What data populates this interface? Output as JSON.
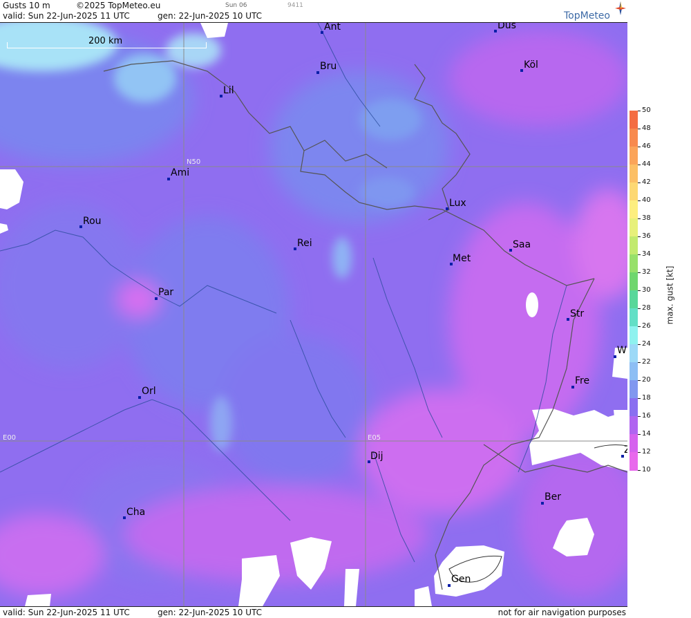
{
  "header": {
    "product": "Gusts 10 m",
    "copyright": "©2025 TopMeteo.eu",
    "run_tag": "Sun 06",
    "code": "9411",
    "valid": "valid:  Sun  22-Jun-2025  11 UTC",
    "gen": "gen: 22-Jun-2025 10 UTC",
    "logo_text": "TopMeteo"
  },
  "footer": {
    "valid": "valid:  Sun  22-Jun-2025  11 UTC",
    "gen": "gen: 22-Jun-2025 10 UTC",
    "disclaimer": "not for air navigation purposes"
  },
  "map": {
    "scale_label": "200 km",
    "grid_labels": [
      "N50",
      "E00",
      "E05"
    ],
    "cities": [
      "Ant",
      "Düs",
      "Bru",
      "Köl",
      "Lil",
      "Ami",
      "Lux",
      "Rou",
      "Rei",
      "Saa",
      "Met",
      "Par",
      "Str",
      "W",
      "Fre",
      "Orl",
      "Dij",
      "Ber",
      "Cha",
      "Gen",
      "Z"
    ]
  },
  "colorbar": {
    "title": "max. gust  [kt]",
    "ticks": [
      "50",
      "48",
      "46",
      "44",
      "42",
      "40",
      "38",
      "36",
      "34",
      "32",
      "30",
      "28",
      "26",
      "24",
      "22",
      "20",
      "18",
      "16",
      "14",
      "12",
      "10"
    ],
    "colors": [
      "#f46d43",
      "#f88a4e",
      "#fba45a",
      "#fcbf66",
      "#fdd873",
      "#fdee7f",
      "#e7f07a",
      "#c2ea6e",
      "#97e06a",
      "#6fd66e",
      "#58d79a",
      "#63dfc6",
      "#8ff2ef",
      "#9cd9f7",
      "#8dbef4",
      "#8198ef",
      "#8a6ff0",
      "#b065f0",
      "#d563ee",
      "#e869ec"
    ]
  },
  "colors": {
    "field_base": "#8f6ef0",
    "field_blue": "#7b84ef",
    "field_light": "#9ad2f6",
    "field_pink": "#cc6ef0",
    "no_data": "#ffffff"
  }
}
